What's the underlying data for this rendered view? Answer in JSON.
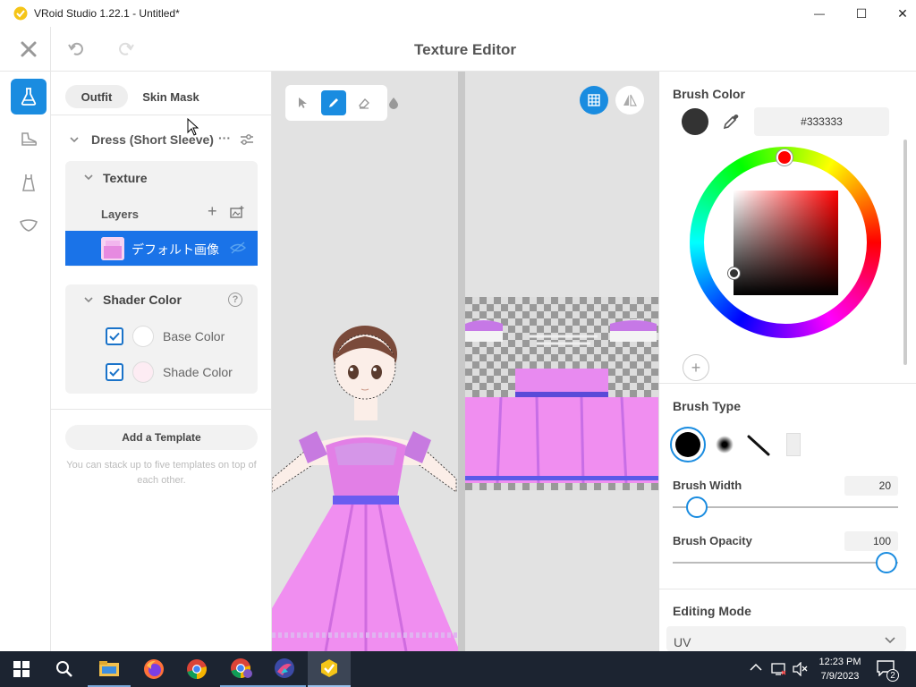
{
  "window": {
    "title": "VRoid Studio 1.22.1 - Untitled*",
    "minimize_symbol": "—",
    "maximize_symbol": "☐",
    "close_symbol": "✕"
  },
  "header": {
    "title": "Texture Editor",
    "close_icon": "close-icon",
    "undo_icon": "undo-icon",
    "redo_icon": "redo-icon"
  },
  "rail": {
    "items": [
      {
        "icon": "flask-icon",
        "active": true
      },
      {
        "icon": "shoe-icon",
        "active": false
      },
      {
        "icon": "dress-icon",
        "active": false
      },
      {
        "icon": "accessory-icon",
        "active": false
      }
    ]
  },
  "left_panel": {
    "tabs": [
      {
        "label": "Outfit",
        "active": true
      },
      {
        "label": "Skin Mask",
        "active": false
      }
    ],
    "item": {
      "name": "Dress (Short Sleeve)",
      "more_symbol": "···"
    },
    "texture": {
      "title": "Texture",
      "layers_label": "Layers",
      "add_symbol": "+",
      "layer": {
        "name": "デフォルト画像"
      }
    },
    "shader_color": {
      "title": "Shader Color",
      "help_symbol": "?",
      "rows": [
        {
          "label": "Base Color",
          "checked": true,
          "color": "#ffffff"
        },
        {
          "label": "Shade Color",
          "checked": true,
          "color": "#fdecf3"
        }
      ]
    },
    "template": {
      "button_label": "Add a Template",
      "hint": "You can stack up to five templates on top of each other."
    }
  },
  "viewport": {
    "tools": [
      "select-icon",
      "pen-icon",
      "eraser-icon",
      "fill-icon"
    ],
    "active_tool": "pen-icon",
    "grid_toggle": "grid-icon",
    "mirror_toggle": "mirror-icon"
  },
  "right_panel": {
    "brush_color": {
      "title": "Brush Color",
      "hex": "#333333",
      "eyedropper_icon": "eyedropper-icon",
      "add_symbol": "+"
    },
    "brush_type": {
      "title": "Brush Type",
      "types": [
        "hard-brush",
        "soft-brush",
        "line-brush",
        "texture-brush"
      ],
      "selected": "hard-brush"
    },
    "brush_width": {
      "label": "Brush Width",
      "value": "20",
      "fraction": 0.1
    },
    "brush_opacity": {
      "label": "Brush Opacity",
      "value": "100",
      "fraction": 1.0
    },
    "editing_mode": {
      "title": "Editing Mode",
      "value": "UV"
    }
  },
  "taskbar": {
    "time": "12:23 PM",
    "date": "7/9/2023",
    "notification_count": "2",
    "apps": [
      "search-icon",
      "file-explorer-icon",
      "firefox-icon",
      "chrome-icon",
      "chrome-profile-icon",
      "krita-icon",
      "vroid-icon"
    ]
  },
  "colors": {
    "accent": "#1a8ce0",
    "selection": "#1a73e8",
    "brush": "#333333",
    "taskbar": "#1c2431"
  }
}
